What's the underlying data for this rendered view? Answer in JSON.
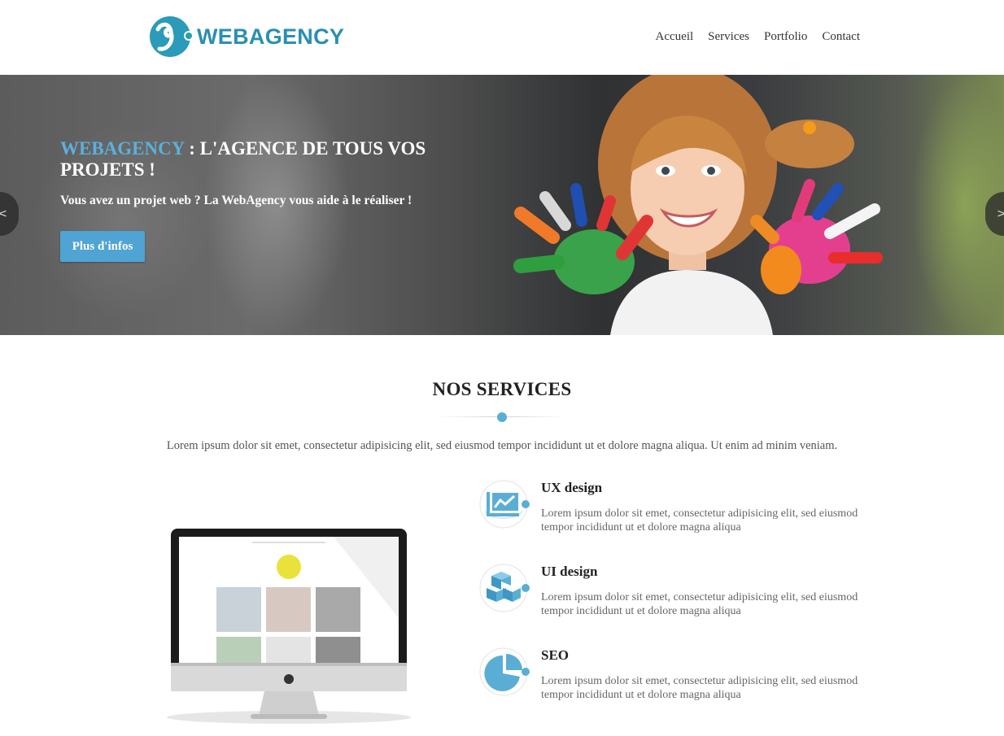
{
  "header": {
    "brand": "WEBAGENCY",
    "logo_icon": "webagency-logo-icon",
    "nav": [
      {
        "label": "Accueil"
      },
      {
        "label": "Services"
      },
      {
        "label": "Portfolio"
      },
      {
        "label": "Contact"
      }
    ]
  },
  "hero": {
    "title_accent": "WEBAGENCY",
    "title_rest": " : L'AGENCE DE TOUS VOS PROJETS !",
    "subtitle": "Vous avez un projet web ? La WebAgency vous aide à le réaliser !",
    "button_label": "Plus d'infos",
    "prev_label": "<",
    "next_label": ">"
  },
  "services": {
    "title": "NOS SERVICES",
    "description": "Lorem ipsum dolor sit emet, consectetur adipisicing elit, sed eiusmod tempor incididunt ut et dolore magna aliqua. Ut enim ad minim veniam.",
    "items": [
      {
        "icon": "chart-icon",
        "name": "UX design",
        "text": "Lorem ipsum dolor sit emet, consectetur adipisicing elit, sed eiusmod tempor incididunt ut et dolore magna aliqua"
      },
      {
        "icon": "cubes-icon",
        "name": "UI design",
        "text": "Lorem ipsum dolor sit emet, consectetur adipisicing elit, sed eiusmod tempor incididunt ut et dolore magna aliqua"
      },
      {
        "icon": "pie-chart-icon",
        "name": "SEO",
        "text": "Lorem ipsum dolor sit emet, consectetur adipisicing elit, sed eiusmod tempor incididunt ut et dolore magna aliqua"
      }
    ]
  },
  "colors": {
    "accent": "#4fa4d3",
    "brand": "#2a8fb1",
    "icon_blue": "#5aaed5"
  }
}
